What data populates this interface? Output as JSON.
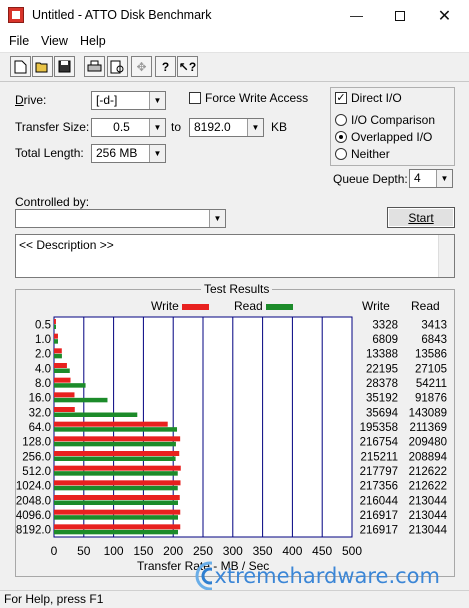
{
  "window": {
    "title": "Untitled - ATTO Disk Benchmark"
  },
  "menu": [
    "File",
    "View",
    "Help"
  ],
  "toolbar_icons": [
    "new-icon",
    "open-icon",
    "save-icon",
    "print-icon",
    "print-preview-icon",
    "move-icon",
    "help-icon",
    "context-help-icon"
  ],
  "form": {
    "drive_label": "Drive:",
    "drive_value": "[-d-]",
    "transfer_size_label": "Transfer Size:",
    "transfer_from": "0.5",
    "to_label": "to",
    "transfer_to": "8192.0",
    "kb_label": "KB",
    "total_length_label": "Total Length:",
    "total_length_value": "256 MB",
    "force_write_label": "Force Write Access",
    "direct_io_label": "Direct I/O",
    "io_comparison_label": "I/O Comparison",
    "overlapped_io_label": "Overlapped I/O",
    "neither_label": "Neither",
    "queue_depth_label": "Queue Depth:",
    "queue_depth_value": "4",
    "controlled_by_label": "Controlled by:",
    "controlled_by_value": "",
    "start_label": "Start",
    "description_text": "<< Description >>"
  },
  "results": {
    "group_title": "Test Results",
    "write_legend": "Write",
    "read_legend": "Read",
    "write_col": "Write",
    "read_col": "Read",
    "xlabel": "Transfer Rate - MB / Sec"
  },
  "chart_data": {
    "type": "bar",
    "orientation": "horizontal",
    "categories": [
      "0.5",
      "1.0",
      "2.0",
      "4.0",
      "8.0",
      "16.0",
      "32.0",
      "64.0",
      "128.0",
      "256.0",
      "512.0",
      "1024.0",
      "2048.0",
      "4096.0",
      "8192.0"
    ],
    "series": [
      {
        "name": "Write",
        "color": "#e8211f",
        "values": [
          3328,
          6809,
          13388,
          22195,
          28378,
          35192,
          35694,
          195358,
          216754,
          215211,
          217797,
          217356,
          216044,
          216917,
          216917
        ]
      },
      {
        "name": "Read",
        "color": "#1c8b2a",
        "values": [
          3413,
          6843,
          13586,
          27105,
          54211,
          91876,
          143089,
          211369,
          209480,
          208894,
          212622,
          212622,
          213044,
          213044,
          213044
        ]
      }
    ],
    "xticks": [
      "0",
      "50",
      "100",
      "150",
      "200",
      "250",
      "300",
      "350",
      "400",
      "450",
      "500"
    ],
    "xlim": [
      0,
      500
    ],
    "value_unit_note": "table values in KB/s; bars plotted in MB/s",
    "xlabel": "Transfer Rate - MB / Sec"
  },
  "status": {
    "text": "For Help, press F1"
  },
  "watermark": {
    "text": "xtremehardware.com"
  }
}
